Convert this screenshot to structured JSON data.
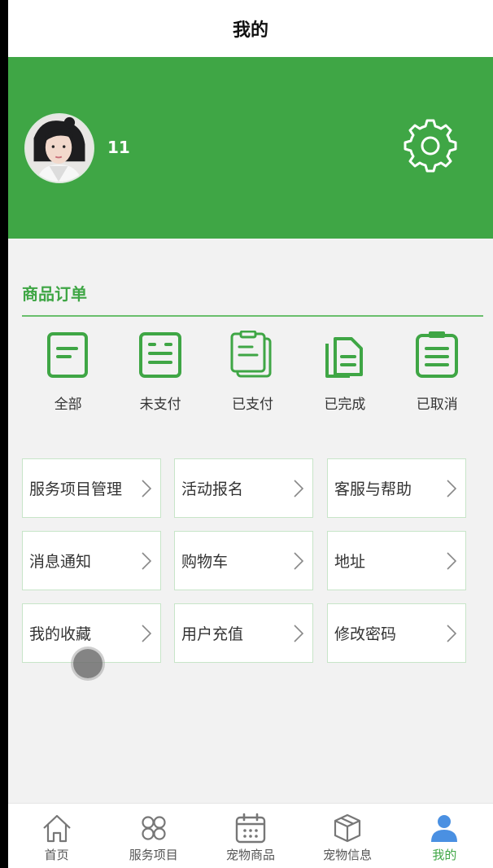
{
  "header": {
    "title": "我的"
  },
  "profile": {
    "username": "11",
    "avatar": "user-avatar-photo",
    "settings_icon": "gear-icon"
  },
  "orders": {
    "title": "商品订单",
    "items": [
      {
        "label": "全部",
        "icon": "document-icon"
      },
      {
        "label": "未支付",
        "icon": "unpaid-icon"
      },
      {
        "label": "已支付",
        "icon": "clipboard-icon"
      },
      {
        "label": "已完成",
        "icon": "files-icon"
      },
      {
        "label": "已取消",
        "icon": "list-clipboard-icon"
      }
    ]
  },
  "menu": [
    {
      "label": "服务项目管理"
    },
    {
      "label": "活动报名"
    },
    {
      "label": "客服与帮助"
    },
    {
      "label": "消息通知"
    },
    {
      "label": "购物车"
    },
    {
      "label": "地址"
    },
    {
      "label": "我的收藏"
    },
    {
      "label": "用户充值"
    },
    {
      "label": "修改密码"
    }
  ],
  "tabbar": [
    {
      "label": "首页",
      "icon": "home-icon",
      "active": false
    },
    {
      "label": "服务项目",
      "icon": "grid-icon",
      "active": false
    },
    {
      "label": "宠物商品",
      "icon": "calendar-icon",
      "active": false
    },
    {
      "label": "宠物信息",
      "icon": "box-icon",
      "active": false
    },
    {
      "label": "我的",
      "icon": "user-icon",
      "active": true
    }
  ],
  "colors": {
    "accent": "#3fa645",
    "background": "#f2f2f2",
    "tile_border": "#c7e5c8"
  }
}
